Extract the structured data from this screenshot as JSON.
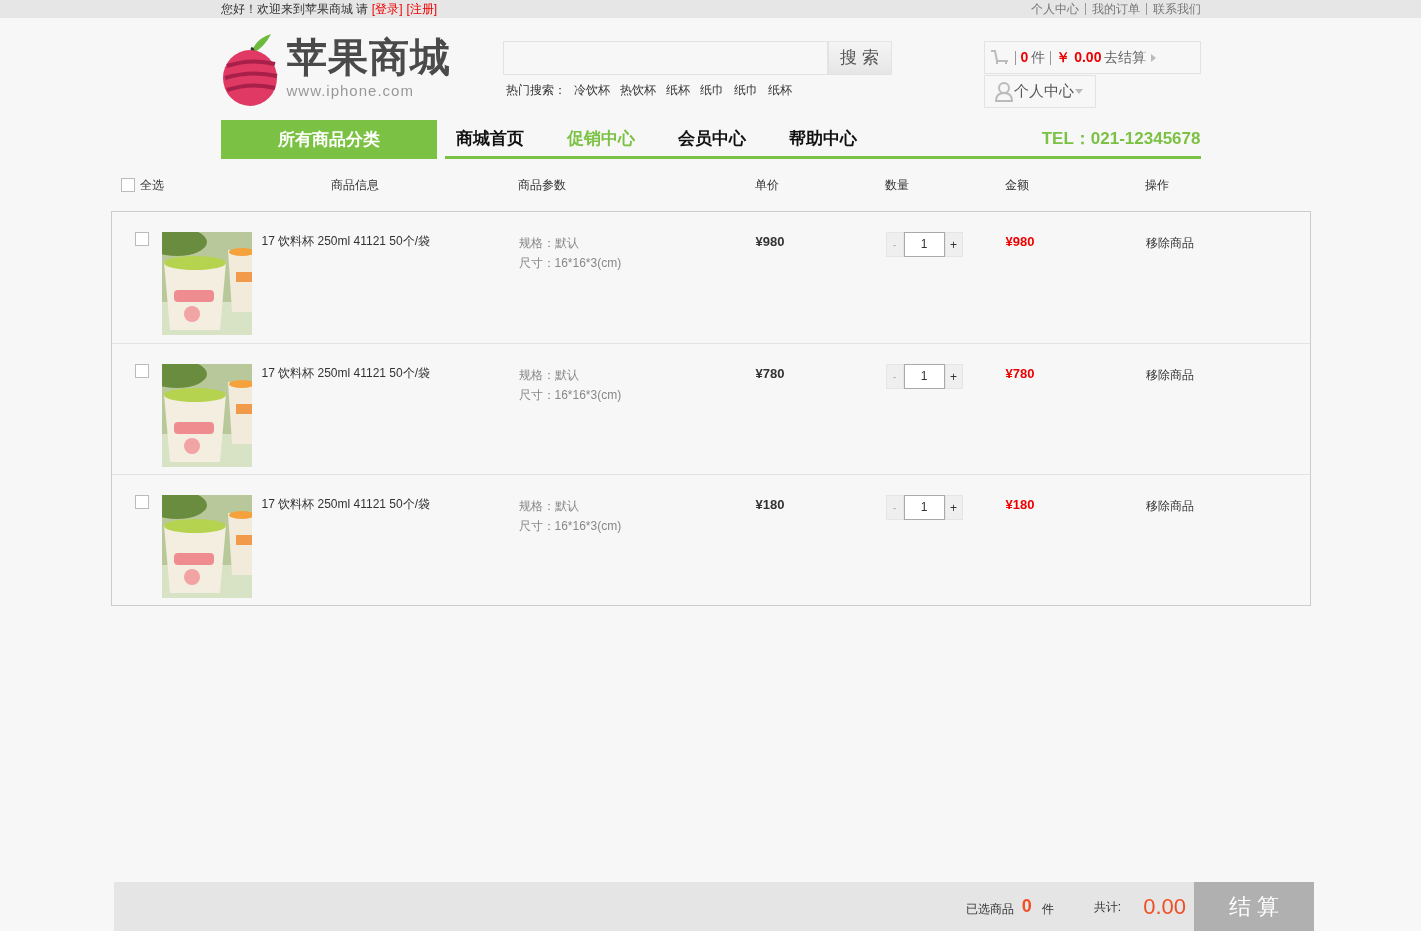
{
  "top_bar": {
    "greeting": "您好！欢迎来到苹果商城 请",
    "login": "[登录]",
    "register": "[注册]",
    "links": [
      "个人中心",
      "我的订单",
      "联系我们"
    ]
  },
  "logo": {
    "name": "苹果商城",
    "url": "www.iphone.com"
  },
  "search": {
    "button": "搜 索",
    "hot_label": "热门搜索：",
    "hot": [
      "冷饮杯",
      "热饮杯",
      "纸杯",
      "纸巾",
      "纸巾",
      "纸杯"
    ]
  },
  "cart_summary": {
    "count": "0",
    "unit": "件",
    "currency": "￥",
    "amount": "0.00",
    "checkout": "去结算"
  },
  "user_menu": {
    "label": "个人中心"
  },
  "nav": {
    "category": "所有商品分类",
    "items": [
      {
        "label": "商城首页",
        "selected": false
      },
      {
        "label": "促销中心",
        "selected": true
      },
      {
        "label": "会员中心",
        "selected": false
      },
      {
        "label": "帮助中心",
        "selected": false
      }
    ],
    "tel": "TEL：021-12345678"
  },
  "table": {
    "select_all": {
      "label": "全选",
      "checked": false
    },
    "columns": [
      "商品信息",
      "商品参数",
      "单价",
      "数量",
      "金额",
      "操作"
    ],
    "rows": [
      {
        "checked": false,
        "name": "17 饮料杯 250ml 41121 50个/袋",
        "spec": "规格：默认",
        "size": "尺寸：16*16*3(cm)",
        "price": "¥980",
        "minus": "-",
        "qty": "1",
        "plus": "+",
        "total": "¥980",
        "action": "移除商品"
      },
      {
        "checked": false,
        "name": "17 饮料杯 250ml 41121 50个/袋",
        "spec": "规格：默认",
        "size": "尺寸：16*16*3(cm)",
        "price": "¥780",
        "minus": "-",
        "qty": "1",
        "plus": "+",
        "total": "¥780",
        "action": "移除商品"
      },
      {
        "checked": false,
        "name": "17 饮料杯 250ml 41121 50个/袋",
        "spec": "规格：默认",
        "size": "尺寸：16*16*3(cm)",
        "price": "¥180",
        "minus": "-",
        "qty": "1",
        "plus": "+",
        "total": "¥180",
        "action": "移除商品"
      }
    ]
  },
  "footer": {
    "selected_label": "已选商品",
    "selected_count": "0",
    "unit": "件",
    "total_label": "共计:",
    "total": "0.00",
    "checkout": "结 算"
  }
}
